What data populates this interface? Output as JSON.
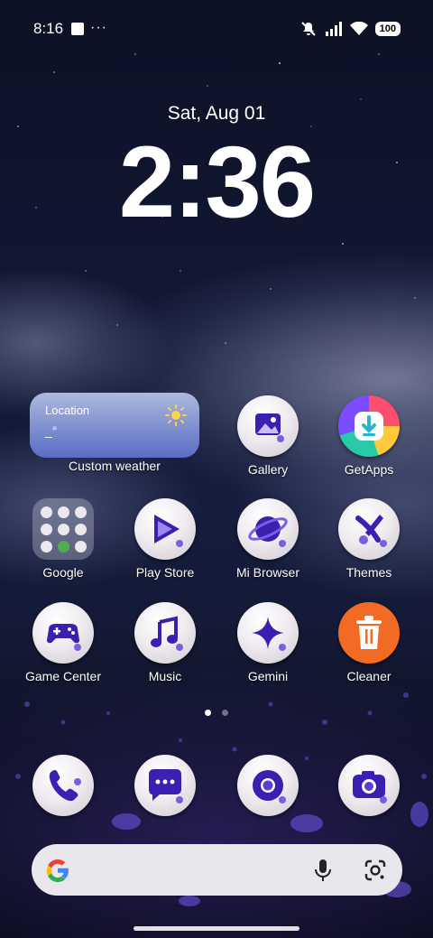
{
  "status_bar": {
    "time": "8:16",
    "dots": "···",
    "battery": "100"
  },
  "lock_clock": {
    "date": "Sat, Aug 01",
    "time": "2:36"
  },
  "weather_widget": {
    "location": "Location",
    "temperature": "_°",
    "label": "Custom weather"
  },
  "apps": [
    {
      "label": "Gallery",
      "icon": "gallery-icon"
    },
    {
      "label": "GetApps",
      "icon": "getapps-icon"
    },
    {
      "label": "Google",
      "icon": "folder-icon"
    },
    {
      "label": "Play Store",
      "icon": "play-store-icon"
    },
    {
      "label": "Mi Browser",
      "icon": "browser-icon"
    },
    {
      "label": "Themes",
      "icon": "themes-icon"
    },
    {
      "label": "Game Center",
      "icon": "gamepad-icon"
    },
    {
      "label": "Music",
      "icon": "music-icon"
    },
    {
      "label": "Gemini",
      "icon": "gemini-icon"
    },
    {
      "label": "Cleaner",
      "icon": "trash-icon"
    }
  ],
  "dock": [
    {
      "icon": "phone-icon"
    },
    {
      "icon": "messages-icon"
    },
    {
      "icon": "chrome-icon"
    },
    {
      "icon": "camera-icon"
    }
  ],
  "pager": {
    "pages": 2,
    "current": 1
  },
  "colors": {
    "accent_purple": "#3b1fb0",
    "cleaner_orange": "#f26a24",
    "search_bg": "#e9e6ec"
  }
}
